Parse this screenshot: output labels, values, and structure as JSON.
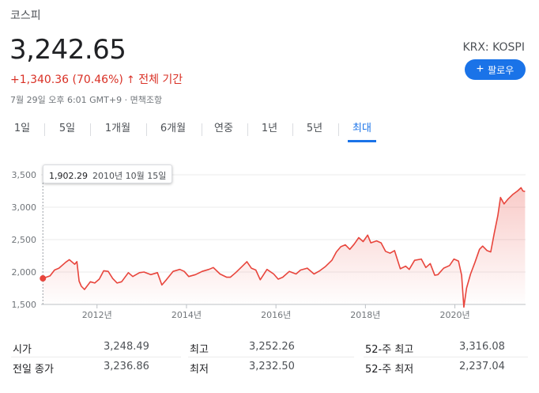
{
  "header": {
    "name": "코스피",
    "price": "3,242.65",
    "change": "+1,340.36 (70.46%)",
    "change_arrow": "↑",
    "period": "전체 기간",
    "timestamp": "7월 29일 오후 6:01 GMT+9 · 면책조항",
    "exchange": "KRX: KOSPI",
    "follow_label": "팔로우",
    "follow_icon": "+"
  },
  "tabs": [
    {
      "label": "1일"
    },
    {
      "label": "5일"
    },
    {
      "label": "1개월"
    },
    {
      "label": "6개월"
    },
    {
      "label": "연중"
    },
    {
      "label": "1년"
    },
    {
      "label": "5년"
    },
    {
      "label": "최대",
      "active": true
    }
  ],
  "tooltip": {
    "value": "1,902.29",
    "date": "2010년 10월 15일"
  },
  "colors": {
    "line": "#e8453c",
    "accent": "#1a73e8",
    "negative": "#d93025"
  },
  "chart_data": {
    "type": "line",
    "y_ticks": [
      "3,500",
      "3,000",
      "2,500",
      "2,000",
      "1,500"
    ],
    "y_values": [
      3500,
      3000,
      2500,
      2000,
      1500
    ],
    "x_ticks": [
      "2012년",
      "2014년",
      "2016년",
      "2018년",
      "2020년"
    ],
    "x_tick_years": [
      2012,
      2014,
      2016,
      2018,
      2020
    ],
    "ylim": [
      1500,
      3500
    ],
    "xlim": [
      2010.75,
      2021.58
    ],
    "grid": true,
    "series": [
      {
        "points": [
          [
            2010.79,
            1902
          ],
          [
            2010.95,
            1940
          ],
          [
            2011.05,
            2030
          ],
          [
            2011.15,
            2060
          ],
          [
            2011.3,
            2150
          ],
          [
            2011.38,
            2190
          ],
          [
            2011.5,
            2120
          ],
          [
            2011.55,
            2160
          ],
          [
            2011.6,
            1860
          ],
          [
            2011.65,
            1780
          ],
          [
            2011.72,
            1730
          ],
          [
            2011.85,
            1850
          ],
          [
            2011.95,
            1830
          ],
          [
            2012.05,
            1890
          ],
          [
            2012.15,
            2020
          ],
          [
            2012.25,
            2010
          ],
          [
            2012.35,
            1900
          ],
          [
            2012.45,
            1830
          ],
          [
            2012.55,
            1850
          ],
          [
            2012.7,
            1990
          ],
          [
            2012.8,
            1930
          ],
          [
            2012.95,
            1990
          ],
          [
            2013.05,
            2000
          ],
          [
            2013.2,
            1960
          ],
          [
            2013.35,
            1990
          ],
          [
            2013.45,
            1800
          ],
          [
            2013.55,
            1880
          ],
          [
            2013.7,
            2010
          ],
          [
            2013.85,
            2040
          ],
          [
            2013.95,
            2010
          ],
          [
            2014.05,
            1930
          ],
          [
            2014.2,
            1960
          ],
          [
            2014.35,
            2010
          ],
          [
            2014.5,
            2040
          ],
          [
            2014.6,
            2070
          ],
          [
            2014.75,
            1970
          ],
          [
            2014.9,
            1920
          ],
          [
            2014.98,
            1920
          ],
          [
            2015.1,
            1990
          ],
          [
            2015.25,
            2090
          ],
          [
            2015.35,
            2160
          ],
          [
            2015.45,
            2060
          ],
          [
            2015.55,
            2030
          ],
          [
            2015.65,
            1880
          ],
          [
            2015.8,
            2040
          ],
          [
            2015.95,
            1970
          ],
          [
            2016.05,
            1890
          ],
          [
            2016.15,
            1920
          ],
          [
            2016.3,
            2010
          ],
          [
            2016.45,
            1970
          ],
          [
            2016.55,
            2030
          ],
          [
            2016.7,
            2060
          ],
          [
            2016.85,
            1970
          ],
          [
            2016.98,
            2020
          ],
          [
            2017.1,
            2080
          ],
          [
            2017.25,
            2180
          ],
          [
            2017.35,
            2310
          ],
          [
            2017.45,
            2390
          ],
          [
            2017.55,
            2420
          ],
          [
            2017.65,
            2350
          ],
          [
            2017.75,
            2430
          ],
          [
            2017.85,
            2530
          ],
          [
            2017.95,
            2470
          ],
          [
            2018.05,
            2570
          ],
          [
            2018.12,
            2450
          ],
          [
            2018.25,
            2480
          ],
          [
            2018.35,
            2450
          ],
          [
            2018.45,
            2320
          ],
          [
            2018.55,
            2290
          ],
          [
            2018.65,
            2330
          ],
          [
            2018.78,
            2050
          ],
          [
            2018.9,
            2090
          ],
          [
            2018.98,
            2040
          ],
          [
            2019.1,
            2180
          ],
          [
            2019.25,
            2200
          ],
          [
            2019.35,
            2070
          ],
          [
            2019.45,
            2130
          ],
          [
            2019.55,
            1950
          ],
          [
            2019.62,
            1960
          ],
          [
            2019.75,
            2060
          ],
          [
            2019.88,
            2100
          ],
          [
            2019.98,
            2200
          ],
          [
            2020.08,
            2170
          ],
          [
            2020.15,
            1950
          ],
          [
            2020.2,
            1457
          ],
          [
            2020.26,
            1750
          ],
          [
            2020.35,
            1970
          ],
          [
            2020.45,
            2150
          ],
          [
            2020.55,
            2350
          ],
          [
            2020.62,
            2400
          ],
          [
            2020.72,
            2330
          ],
          [
            2020.8,
            2310
          ],
          [
            2020.88,
            2600
          ],
          [
            2020.96,
            2870
          ],
          [
            2021.02,
            3150
          ],
          [
            2021.1,
            3050
          ],
          [
            2021.18,
            3120
          ],
          [
            2021.3,
            3200
          ],
          [
            2021.4,
            3250
          ],
          [
            2021.48,
            3300
          ],
          [
            2021.52,
            3250
          ],
          [
            2021.57,
            3243
          ]
        ]
      }
    ]
  },
  "stats": {
    "open_label": "시가",
    "open": "3,248.49",
    "high_label": "최고",
    "high": "3,252.26",
    "wk52_high_label": "52-주 최고",
    "wk52_high": "3,316.08",
    "prev_close_label": "전일 종가",
    "prev_close": "3,236.86",
    "low_label": "최저",
    "low": "3,232.50",
    "wk52_low_label": "52-주 최저",
    "wk52_low": "2,237.04"
  }
}
